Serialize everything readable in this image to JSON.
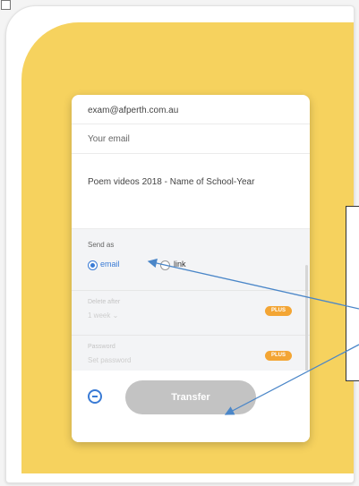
{
  "form": {
    "to_email": "exam@afperth.com.au",
    "your_email_placeholder": "Your email",
    "message": "Poem videos 2018 - Name of School-Year",
    "send_as_label": "Send as",
    "option_email": "email",
    "option_link": "link",
    "selected_option": "email",
    "delete_after_label": "Delete after",
    "delete_after_value": "1 week",
    "password_label": "Password",
    "password_placeholder": "Set password",
    "plus_badge": "PLUS",
    "transfer_label": "Transfer"
  },
  "colors": {
    "panel_yellow": "#f6d25e",
    "accent_blue": "#3a7bd5",
    "plus_orange": "#f3a534",
    "transfer_disabled": "#c3c3c3",
    "arrow_blue": "#4a86c8"
  },
  "icons": {
    "more_options": "minus-circle-icon",
    "delete_after_dropdown": "chevron-down-icon"
  }
}
